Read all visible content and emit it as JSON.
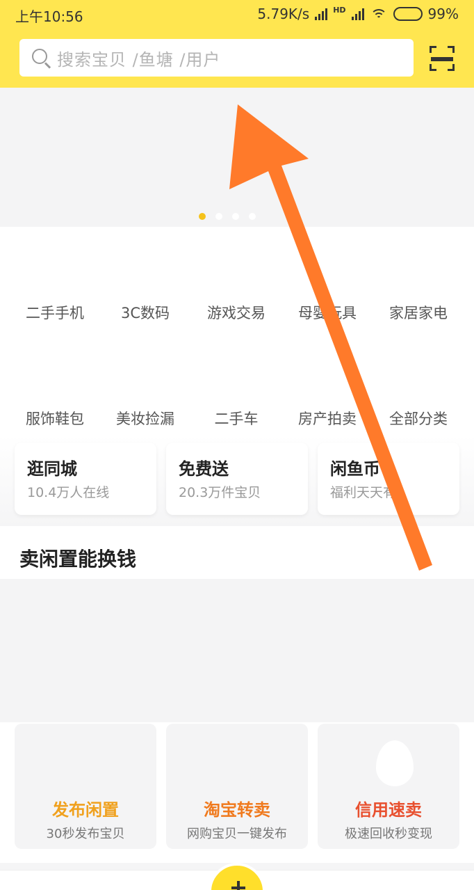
{
  "status_bar": {
    "time": "上午10:56",
    "network_speed": "5.79K/s",
    "network_type": "HD",
    "battery": "99%"
  },
  "search": {
    "placeholder": "搜索宝贝 /鱼塘 /用户"
  },
  "categories": [
    {
      "label": "二手手机"
    },
    {
      "label": "3C数码"
    },
    {
      "label": "游戏交易"
    },
    {
      "label": "母婴玩具"
    },
    {
      "label": "家居家电"
    },
    {
      "label": "服饰鞋包"
    },
    {
      "label": "美妆捡漏"
    },
    {
      "label": "二手车"
    },
    {
      "label": "房产拍卖"
    },
    {
      "label": "全部分类"
    }
  ],
  "quick_cards": [
    {
      "title": "逛同城",
      "subtitle": "10.4万人在线"
    },
    {
      "title": "免费送",
      "subtitle": "20.3万件宝贝"
    },
    {
      "title": "闲鱼币",
      "subtitle": "福利天天有"
    }
  ],
  "sell_section": {
    "title": "卖闲置能换钱",
    "cards": [
      {
        "title": "发布闲置",
        "subtitle": "30秒发布宝贝",
        "color": "#f0a11e"
      },
      {
        "title": "淘宝转卖",
        "subtitle": "网购宝贝一键发布",
        "color": "#f07a1e"
      },
      {
        "title": "信用速卖",
        "subtitle": "极速回收秒变现",
        "color": "#e8502f"
      }
    ]
  },
  "colors": {
    "brand_yellow": "#ffe650",
    "annotation_arrow": "#ff7a2a"
  },
  "icons": [
    "search-icon",
    "scan-icon",
    "signal-icon",
    "wifi-icon",
    "battery-icon",
    "plus-icon"
  ]
}
